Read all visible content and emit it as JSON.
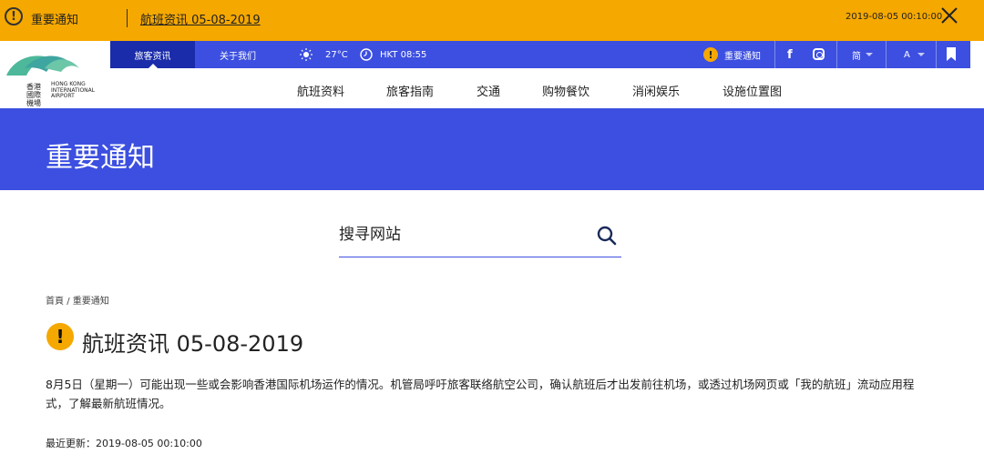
{
  "alert_bar": {
    "title": "重要通知",
    "link": "航班资讯 05-08-2019",
    "time": "2019-08-05 00:10:00",
    "bg_color": "#f5a800"
  },
  "util_bar": {
    "tab_active": "旅客资讯",
    "tab_about": "关于我们",
    "weather_icon": "sun-icon",
    "temperature": "27°C",
    "clock_icon": "clock-icon",
    "hkt_time": "HKT 08:55",
    "notice_label": "重要通知",
    "facebook": "f",
    "instagram_icon": "instagram-icon",
    "language": "简",
    "font_size": "A",
    "bookmark_icon": "bookmark-icon",
    "bg_color": "#3c4fe0"
  },
  "logo": {
    "name_zh": "香港國際機場",
    "name_en": "HONG KONG INTERNATIONAL AIRPORT"
  },
  "main_nav": [
    "航班资料",
    "旅客指南",
    "交通",
    "购物餐饮",
    "消闲娱乐",
    "设施位置图"
  ],
  "banner": {
    "title": "重要通知",
    "bg_color": "#3c4fe0"
  },
  "search": {
    "placeholder": "搜寻网站",
    "icon": "search-icon"
  },
  "breadcrumb": {
    "home": "首頁",
    "separator": "/",
    "current": "重要通知"
  },
  "article": {
    "title": "航班资讯 05-08-2019",
    "body": "8月5日（星期一）可能出现一些或会影响香港国际机场运作的情况。机管局呼吁旅客联络航空公司，确认航班后才出发前往机场，或透过机场网页或「我的航班」流动应用程式，了解最新航班情况。",
    "updated_label": "最近更新：",
    "updated_time": "2019-08-05 00:10:00"
  }
}
